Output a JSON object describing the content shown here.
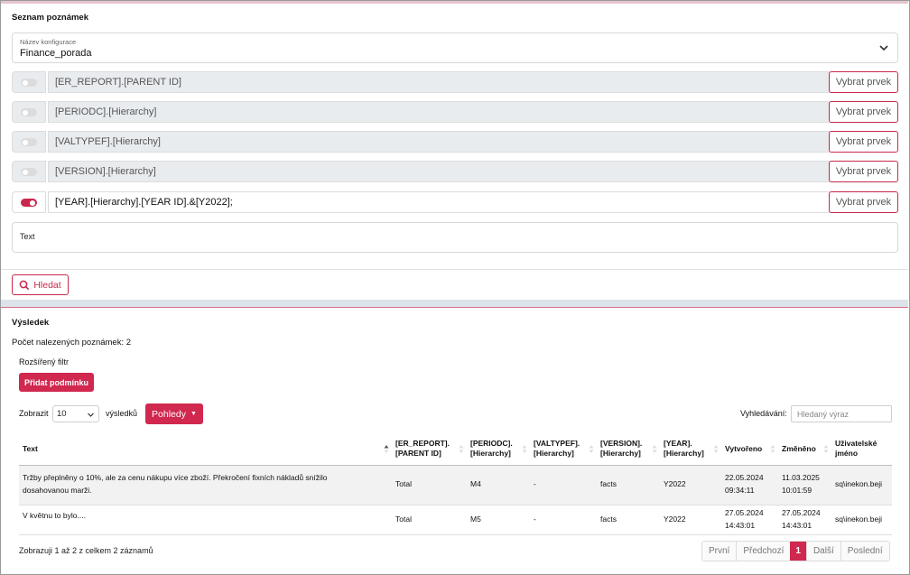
{
  "filter_section": {
    "title": "Seznam poznámek",
    "config": {
      "label": "Název konfigurace",
      "value": "Finance_porada"
    },
    "rows": [
      {
        "value": "[ER_REPORT].[PARENT ID]",
        "enabled": false
      },
      {
        "value": "[PERIODC].[Hierarchy]",
        "enabled": false
      },
      {
        "value": "[VALTYPEF].[Hierarchy]",
        "enabled": false
      },
      {
        "value": "[VERSION].[Hierarchy]",
        "enabled": false
      },
      {
        "value": "[YEAR].[Hierarchy].[YEAR ID].&[Y2022];",
        "enabled": true
      }
    ],
    "pick_label": "Vybrat prvek",
    "text_label": "Text",
    "search_label": "Hledat"
  },
  "result": {
    "title": "Výsledek",
    "count_text": "Počet nalezených poznámek: 2",
    "advanced_filter": "Rozšířený filtr",
    "add_condition": "Přidat podmínku",
    "show_label": "Zobrazit",
    "page_size": "10",
    "results_label": "výsledků",
    "views_label": "Pohledy",
    "search_label": "Vyhledávání:",
    "search_placeholder": "Hledaný výraz",
    "columns": [
      {
        "l1": "Text",
        "l2": ""
      },
      {
        "l1": "[ER_REPORT].",
        "l2": "[PARENT ID]"
      },
      {
        "l1": "[PERIODC].",
        "l2": "[Hierarchy]"
      },
      {
        "l1": "[VALTYPEF].",
        "l2": "[Hierarchy]"
      },
      {
        "l1": "[VERSION].",
        "l2": "[Hierarchy]"
      },
      {
        "l1": "[YEAR].",
        "l2": "[Hierarchy]"
      },
      {
        "l1": "Vytvořeno",
        "l2": ""
      },
      {
        "l1": "Změněno",
        "l2": ""
      },
      {
        "l1": "Uživatelské",
        "l2": "jméno"
      }
    ],
    "rows": [
      {
        "text_l1": "Tržby přeplněny o 10%, ale za cenu nákupu více zboží. Překročení fixních nákladů snížilo",
        "text_l2": "dosahovanou marži.",
        "er_report": "Total",
        "periodc": "M4",
        "valtypef": "-",
        "version": "facts",
        "year": "Y2022",
        "created_date": "22.05.2024",
        "created_time": "09:34:11",
        "changed_date": "11.03.2025",
        "changed_time": "10:01:59",
        "user": "sq\\inekon.beji"
      },
      {
        "text_l1": "V květnu to bylo....",
        "text_l2": "",
        "er_report": "Total",
        "periodc": "M5",
        "valtypef": "-",
        "version": "facts",
        "year": "Y2022",
        "created_date": "27.05.2024",
        "created_time": "14:43:01",
        "changed_date": "27.05.2024",
        "changed_time": "14:43:01",
        "user": "sq\\inekon.beji"
      }
    ],
    "info": "Zobrazuji 1 až 2 z celkem 2 záznamů",
    "pager": {
      "first": "První",
      "prev": "Předchozí",
      "current": "1",
      "next": "Další",
      "last": "Poslední"
    }
  },
  "colors": {
    "accent": "#c8284c",
    "band": "#dde3ea"
  }
}
